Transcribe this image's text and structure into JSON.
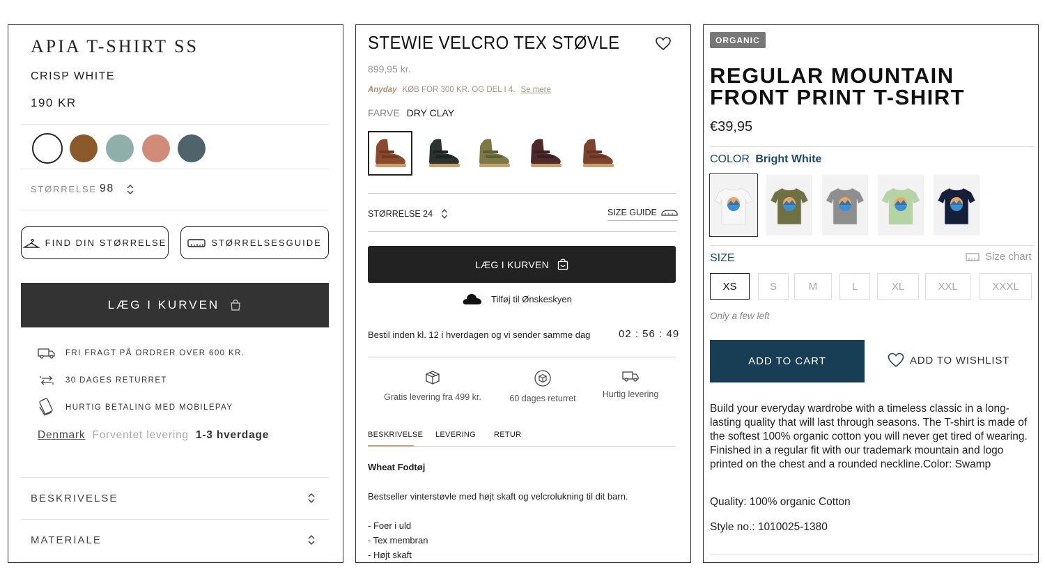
{
  "panel1": {
    "title": "APIA T-SHIRT SS",
    "color_name": "CRISP WHITE",
    "price": "190 KR",
    "swatches": [
      "#ffffff",
      "#8b5a2b",
      "#8fb0aa",
      "#d08c78",
      "#4f636b"
    ],
    "size_label": "STØRRELSE",
    "size_value": "98",
    "find_size_label": "FIND DIN STØRRELSE",
    "size_guide_label": "STØRRELSESGUIDE",
    "cart_label": "LÆG I KURVEN",
    "features": [
      {
        "icon": "truck-icon",
        "text": "FRI FRAGT PÅ ORDRER OVER 600 KR."
      },
      {
        "icon": "return-arrows-icon",
        "text": "30 DAGES RETURRET"
      },
      {
        "icon": "phone-payment-icon",
        "text": "HURTIG BETALING MED MOBILEPAY"
      }
    ],
    "delivery": {
      "country": "Denmark",
      "label": "Forventet levering",
      "value": "1-3 hverdage"
    },
    "accordions": [
      "BESKRIVELSE",
      "MATERIALE"
    ]
  },
  "panel2": {
    "title": "STEWIE VELCRO TEX STØVLE",
    "price": "899,95 kr.",
    "anyday_brand": "Anyday",
    "anyday_text": "KØB FOR 300 KR. OG DEL I 4.",
    "anyday_link": "Se mere",
    "color_label": "FARVE",
    "color_value": "DRY CLAY",
    "thumbs": [
      {
        "name": "boot-brown",
        "color": "#8a4a2e",
        "strap": "#6f3a22"
      },
      {
        "name": "boot-black",
        "color": "#2b3331",
        "strap": "#1d2422"
      },
      {
        "name": "boot-olive",
        "color": "#7b7a45",
        "strap": "#5f5e33"
      },
      {
        "name": "boot-plum",
        "color": "#4e2a2c",
        "strap": "#3a1e20"
      },
      {
        "name": "boot-clay",
        "color": "#7d4330",
        "strap": "#633323"
      }
    ],
    "size_label": "STØRRELSE 24",
    "size_guide": "SIZE GUIDE",
    "cart_label": "LÆG I KURVEN",
    "wish_label": "Tilføj til Ønskeskyen",
    "order_text": "Bestil inden kl. 12 i hverdagen og vi sender samme dag",
    "timer": "02 : 56 : 49",
    "perks": [
      "Gratis levering fra 499 kr.",
      "60 dages returret",
      "Hurtig levering"
    ],
    "tabs": [
      "BESKRIVELSE",
      "LEVERING",
      "RETUR"
    ],
    "brand": "Wheat Fodtøj",
    "description": "Bestseller vinterstøvle med højt skaft og velcrolukning til dit barn.",
    "bullets": [
      "- Foer i uld",
      "- Tex membran",
      "- Højt skaft"
    ]
  },
  "panel3": {
    "badge": "ORGANIC",
    "title_line1": "REGULAR MOUNTAIN",
    "title_line2": "FRONT PRINT T-SHIRT",
    "price": "€39,95",
    "color_label": "COLOR",
    "color_value": "Bright White",
    "tees": [
      {
        "name": "tee-white",
        "color": "#f7f7f7"
      },
      {
        "name": "tee-olive",
        "color": "#6f7142"
      },
      {
        "name": "tee-grey",
        "color": "#8e8e8e"
      },
      {
        "name": "tee-mint",
        "color": "#b5d4a4"
      },
      {
        "name": "tee-navy",
        "color": "#14203a"
      }
    ],
    "size_label": "SIZE",
    "size_chart": "Size chart",
    "sizes": [
      "XS",
      "S",
      "M",
      "L",
      "XL",
      "XXL",
      "XXXL"
    ],
    "selected_size": "XS",
    "stock_note": "Only a few left",
    "cart_label": "ADD TO CART",
    "wishlist_label": "ADD TO WISHLIST",
    "description": "Build your everyday wardrobe with a timeless classic in a long-lasting quality that will last through seasons. The T-shirt is made of the softest 100% organic cotton you will never get tired of wearing. Finished in a regular fit with our trademark mountain and logo printed on the chest and a rounded neckline.Color: Swamp",
    "quality": "Quality: 100% organic Cotton",
    "style_no": "Style no.: 1010025-1380",
    "accent": "#173e55"
  }
}
